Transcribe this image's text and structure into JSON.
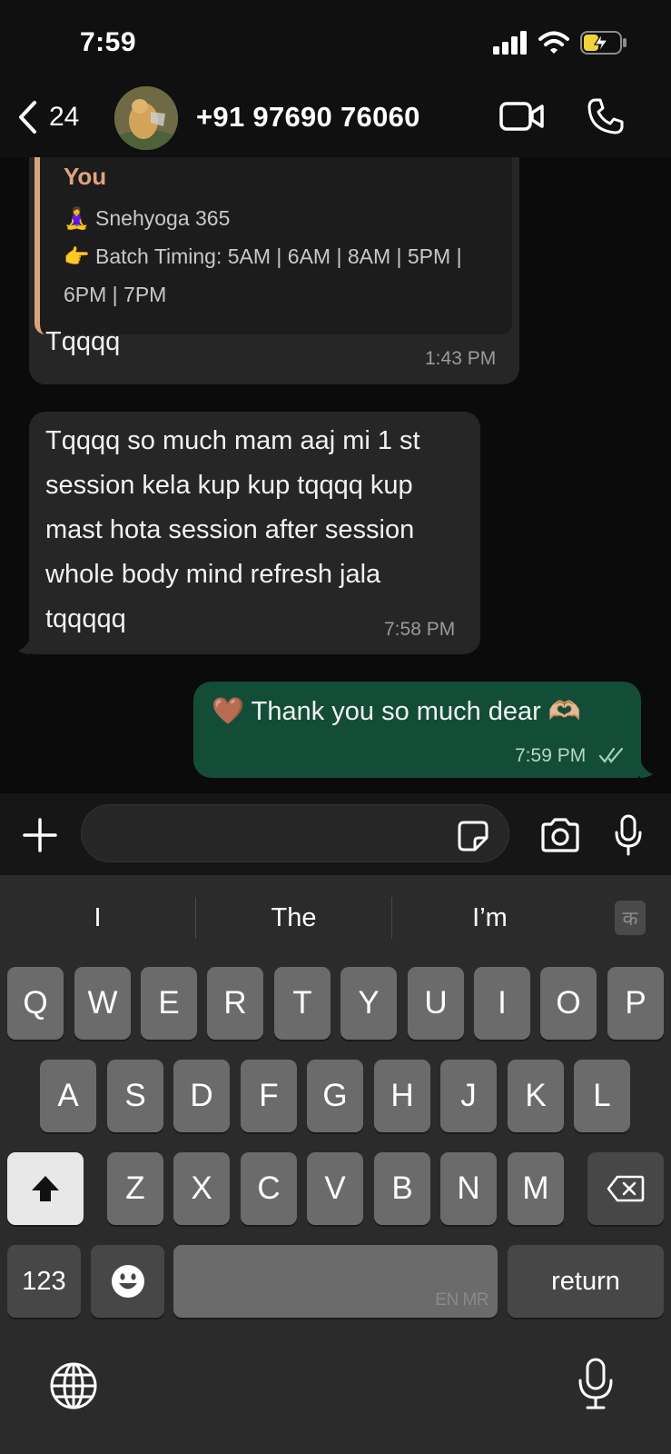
{
  "status_bar": {
    "time": "7:59"
  },
  "header": {
    "back_count": "24",
    "contact_name": "+91 97690 76060"
  },
  "messages": {
    "quoted": {
      "author": "You",
      "line1": "🧘‍♀️ Snehyoga 365",
      "line2": "👉 Batch Timing: 5AM | 6AM | 8AM | 5PM |",
      "line3": "6PM | 7PM"
    },
    "reply": {
      "text": "Tqqqq",
      "time": "1:43 PM"
    },
    "incoming": {
      "line1": "Tqqqq so much mam aaj mi 1 st",
      "line2": "session kela kup kup tqqqq kup",
      "line3": "mast hota session after session",
      "line4": "whole body mind refresh jala",
      "line5": "tqqqqq",
      "time": "7:58 PM"
    },
    "outgoing": {
      "text": "🤎 Thank you so much dear 🫶🏼",
      "time": "7:59 PM"
    }
  },
  "keyboard": {
    "suggestions": [
      "I",
      "The",
      "I’m"
    ],
    "lang_key": "क",
    "row1": [
      "Q",
      "W",
      "E",
      "R",
      "T",
      "Y",
      "U",
      "I",
      "O",
      "P"
    ],
    "row2": [
      "A",
      "S",
      "D",
      "F",
      "G",
      "H",
      "J",
      "K",
      "L"
    ],
    "row3": [
      "Z",
      "X",
      "C",
      "V",
      "B",
      "N",
      "M"
    ],
    "numbers_key": "123",
    "space_hint": "EN MR",
    "return_key": "return"
  },
  "colors": {
    "outgoing_bubble": "#144d37",
    "incoming_bubble": "#262626",
    "quote_accent": "#d9a47a",
    "read_ticks": "#9fd3bf"
  },
  "icons": [
    "back-chevron-icon",
    "video-call-icon",
    "phone-icon",
    "plus-icon",
    "sticker-icon",
    "camera-icon",
    "microphone-icon",
    "emoji-icon",
    "backspace-icon",
    "shift-icon",
    "globe-icon"
  ]
}
